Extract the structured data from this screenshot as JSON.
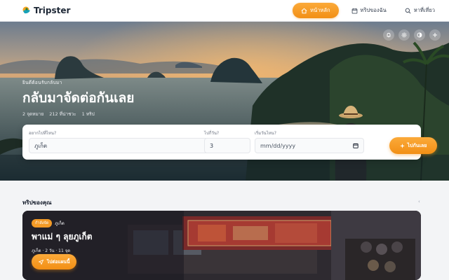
{
  "app": {
    "name": "Tripster"
  },
  "nav": {
    "items": [
      {
        "label": "หน้าหลัก",
        "icon": "home-icon",
        "active": true
      },
      {
        "label": "ทริปของฉัน",
        "icon": "calendar-icon",
        "active": false
      },
      {
        "label": "หาที่เที่ยว",
        "icon": "search-icon",
        "active": false
      }
    ]
  },
  "hero": {
    "eyebrow": "ยินดีต้อนรับกลับมา",
    "title": "กลับมาจัดต่อกันเลย",
    "stats": [
      "2 จุดหมาย",
      "212 ที่น่าชวะ",
      "1 ทริป"
    ],
    "actions": [
      "bell-icon",
      "gear-icon",
      "contrast-icon",
      "plus-icon"
    ]
  },
  "search": {
    "where_label": "อยากไปที่ไหน?",
    "where_value": "ภูเก็ต",
    "days_label": "ไปกี่วัน?",
    "days_value": "3",
    "date_label": "เริ่มวันไหน?",
    "date_placeholder": "mm/dd/yyyy",
    "submit_label": "ไปกันเลย"
  },
  "trips": {
    "title": "ทริปของคุณ",
    "more": "‹",
    "card": {
      "badge": "กำลังจัด",
      "place": "ภูเก็ต",
      "title": "พาแม่ ๆ ลุยภูเก็ต",
      "meta": "ภูเก็ต · 2 วัน · 11 จุด",
      "button_label": "ไปต่อแผนนี้"
    }
  },
  "colors": {
    "accent": "#f39a26",
    "text": "#1f2937",
    "background": "#f3f4f6"
  }
}
